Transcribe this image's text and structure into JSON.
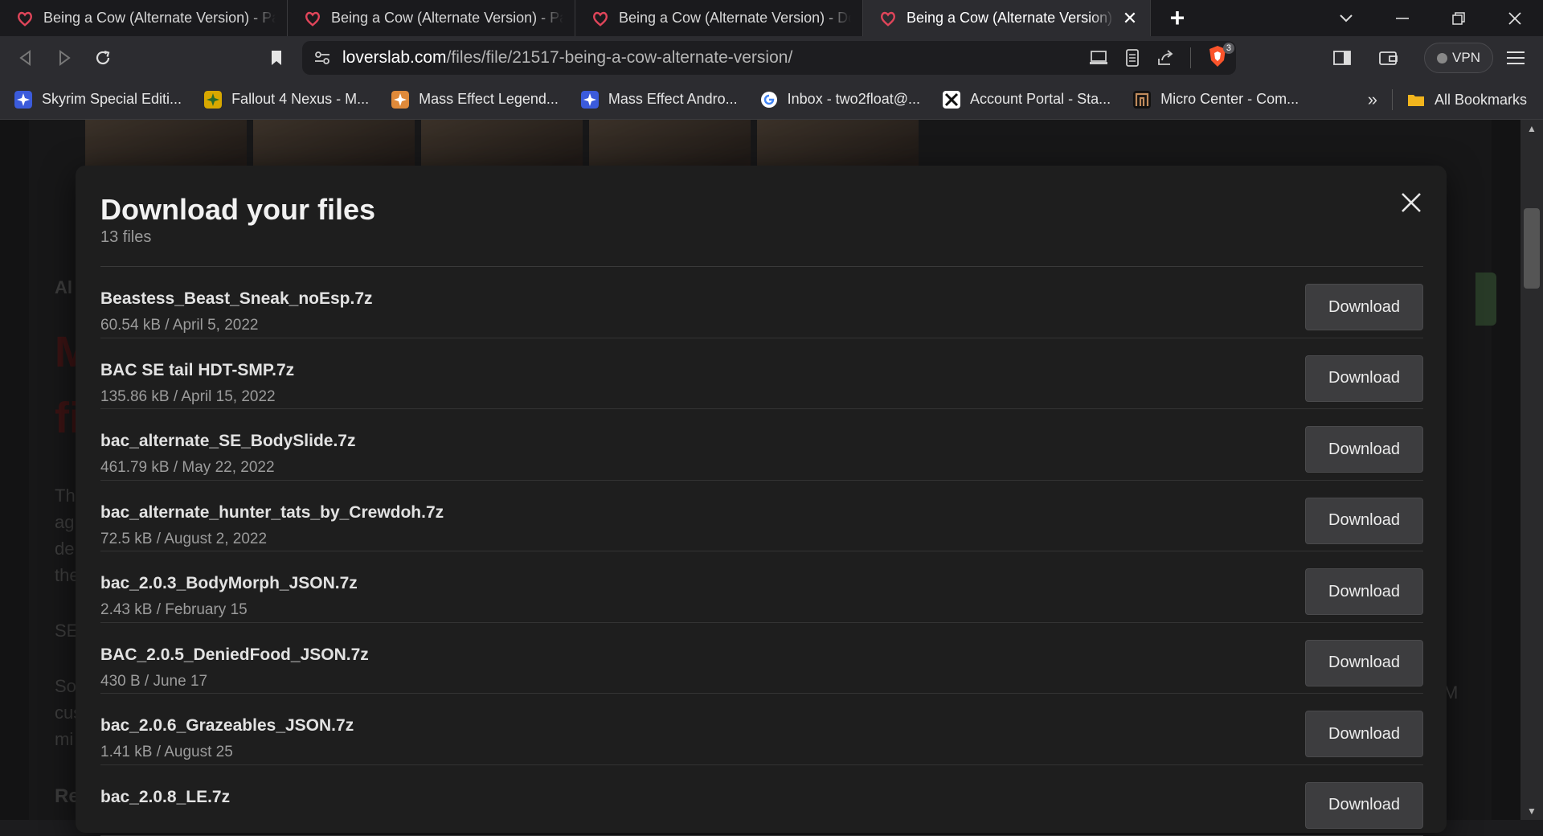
{
  "browser": {
    "tabs": [
      {
        "title": "Being a Cow (Alternate Version) - Page"
      },
      {
        "title": "Being a Cow (Alternate Version) - Page"
      },
      {
        "title": "Being a Cow (Alternate Version) - Dow"
      },
      {
        "title": "Being a Cow (Alternate Version) -"
      }
    ],
    "url_domain": "loverslab.com",
    "url_path": "/files/file/21517-being-a-cow-alternate-version/",
    "brave_badge": "3",
    "vpn_label": "VPN",
    "bookmarks": [
      {
        "label": "Skyrim Special Editi...",
        "icon": "skyrim-icon",
        "color": "#3b5bdb"
      },
      {
        "label": "Fallout 4 Nexus - M...",
        "icon": "nexus-icon",
        "color": "#d8a800"
      },
      {
        "label": "Mass Effect Legend...",
        "icon": "nexus-icon",
        "color": "#e08a3a"
      },
      {
        "label": "Mass Effect Andro...",
        "icon": "nexus-icon",
        "color": "#3b5bdb"
      },
      {
        "label": "Inbox - two2float@...",
        "icon": "google-icon",
        "color": "#ffffff"
      },
      {
        "label": "Account Portal - Sta...",
        "icon": "x-icon",
        "color": "#ffffff"
      },
      {
        "label": "Micro Center - Com...",
        "icon": "microcenter-icon",
        "color": "#c08b5c"
      }
    ],
    "all_bookmarks_label": "All Bookmarks"
  },
  "modal": {
    "title": "Download your files",
    "subtitle": "13 files",
    "download_label": "Download",
    "files": [
      {
        "name": "Beastess_Beast_Sneak_noEsp.7z",
        "meta": "60.54 kB / April 5, 2022"
      },
      {
        "name": "BAC SE tail HDT-SMP.7z",
        "meta": "135.86 kB / April 15, 2022"
      },
      {
        "name": "bac_alternate_SE_BodySlide.7z",
        "meta": "461.79 kB / May 22, 2022"
      },
      {
        "name": "bac_alternate_hunter_tats_by_Crewdoh.7z",
        "meta": "72.5 kB / August 2, 2022"
      },
      {
        "name": "bac_2.0.3_BodyMorph_JSON.7z",
        "meta": "2.43 kB / February 15"
      },
      {
        "name": "BAC_2.0.5_DeniedFood_JSON.7z",
        "meta": "430 B / June 17"
      },
      {
        "name": "bac_2.0.6_Grazeables_JSON.7z",
        "meta": "1.41 kB / August 25"
      },
      {
        "name": "bac_2.0.8_LE.7z",
        "meta": ""
      }
    ]
  },
  "background": {
    "partial_texts": [
      "Al",
      "M",
      "fi",
      "Thi",
      "ag",
      "de",
      "the",
      "SE",
      "So,",
      "cus",
      "mi",
      "Re",
      "M"
    ]
  }
}
